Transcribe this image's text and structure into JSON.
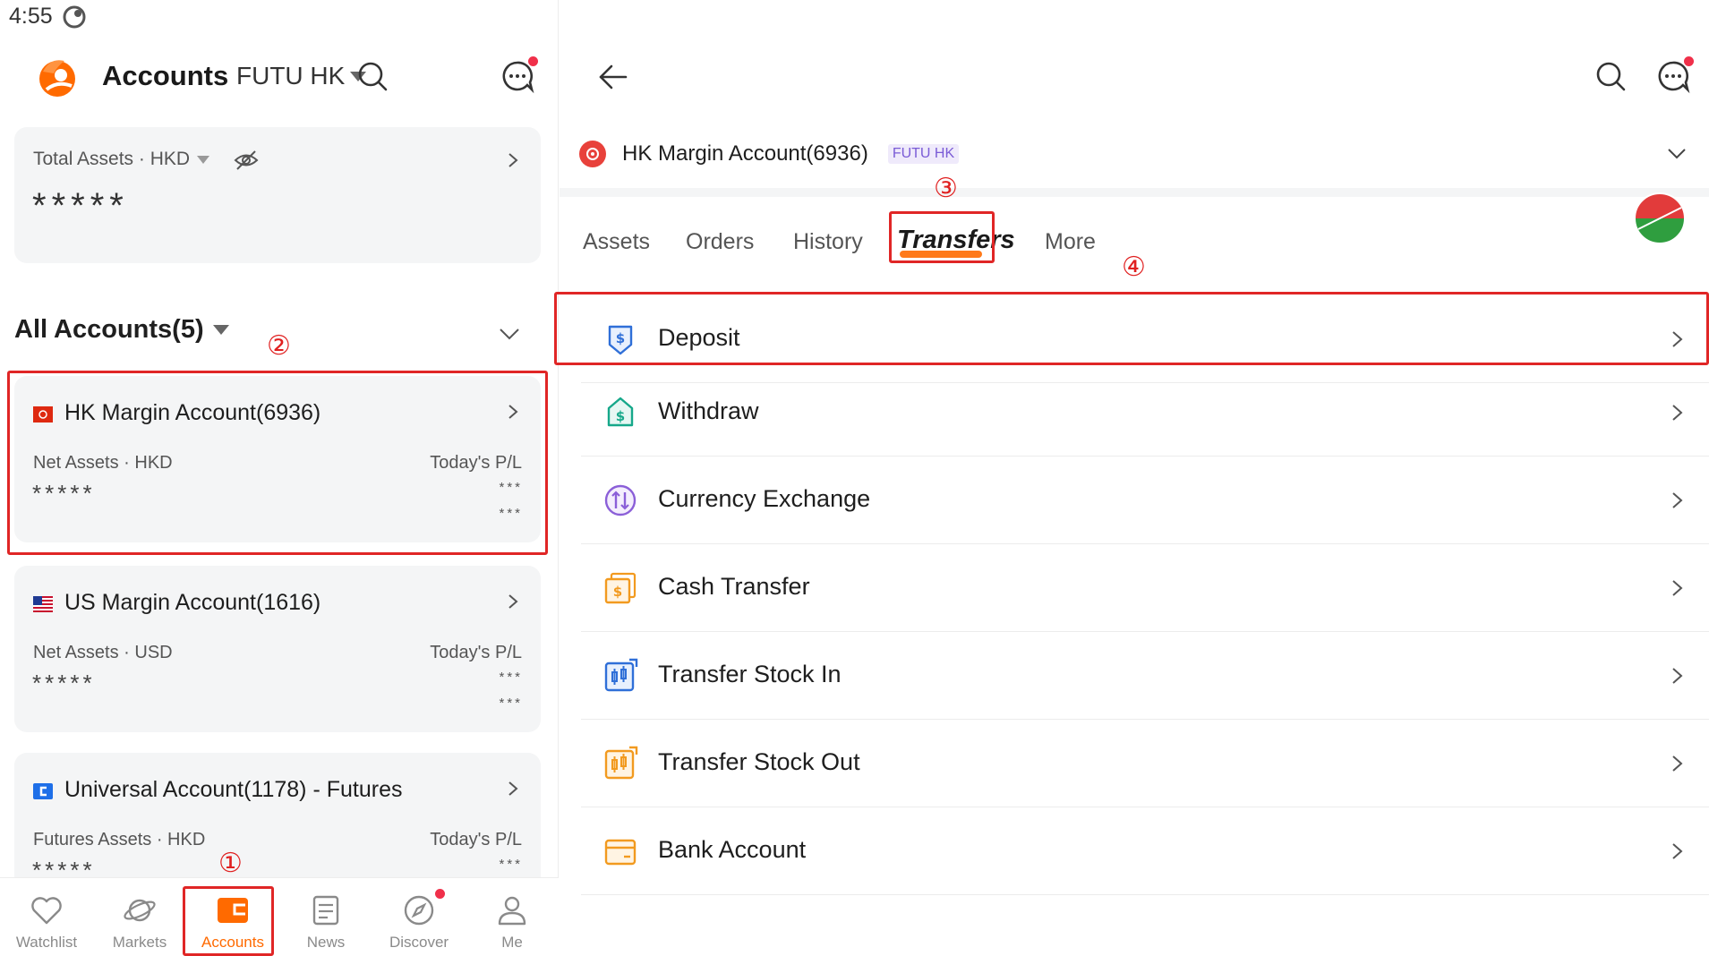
{
  "status_bar": {
    "time": "4:55"
  },
  "left": {
    "header": {
      "title": "Accounts",
      "broker": "FUTU HK"
    },
    "total_assets": {
      "label": "Total Assets · HKD",
      "value_masked": "*****"
    },
    "all_accounts": {
      "title": "All Accounts(5)"
    },
    "accounts": [
      {
        "name": "HK Margin Account(6936)",
        "sub_label": "Net Assets · HKD",
        "pl_label": "Today's P/L",
        "value_masked": "*****",
        "pl_masked_1": "***",
        "pl_masked_2": "***"
      },
      {
        "name": "US Margin Account(1616)",
        "sub_label": "Net Assets · USD",
        "pl_label": "Today's P/L",
        "value_masked": "*****",
        "pl_masked_1": "***",
        "pl_masked_2": "***"
      },
      {
        "name": "Universal Account(1178) - Futures",
        "sub_label": "Futures Assets · HKD",
        "pl_label": "Today's P/L",
        "value_masked": "*****",
        "pl_masked_1": "***"
      }
    ],
    "tabbar": [
      {
        "label": "Watchlist",
        "icon": "heart-icon"
      },
      {
        "label": "Markets",
        "icon": "planet-icon"
      },
      {
        "label": "Accounts",
        "icon": "wallet-icon",
        "active": true
      },
      {
        "label": "News",
        "icon": "news-icon"
      },
      {
        "label": "Discover",
        "icon": "compass-icon"
      },
      {
        "label": "Me",
        "icon": "person-icon"
      }
    ]
  },
  "annotations": {
    "step1": "①",
    "step2": "②",
    "step3": "③",
    "step4": "④"
  },
  "right": {
    "selected_account": {
      "name": "HK Margin Account(6936)",
      "badge": "FUTU HK"
    },
    "tabs": [
      {
        "label": "Assets"
      },
      {
        "label": "Orders"
      },
      {
        "label": "History"
      },
      {
        "label": "Transfers",
        "active": true
      },
      {
        "label": "More"
      }
    ],
    "menu": [
      {
        "label": "Deposit",
        "icon": "deposit-icon"
      },
      {
        "label": "Withdraw",
        "icon": "withdraw-icon"
      },
      {
        "label": "Currency Exchange",
        "icon": "currency-exchange-icon"
      },
      {
        "label": "Cash Transfer",
        "icon": "cash-transfer-icon"
      },
      {
        "label": "Transfer Stock In",
        "icon": "transfer-stock-in-icon"
      },
      {
        "label": "Transfer Stock Out",
        "icon": "transfer-stock-out-icon"
      },
      {
        "label": "Bank Account",
        "icon": "bank-account-icon"
      }
    ]
  },
  "colors": {
    "accent": "#ff6a00",
    "highlight_box": "#e02626",
    "badge_text": "#7a5bd6",
    "notification": "#f0304a"
  }
}
